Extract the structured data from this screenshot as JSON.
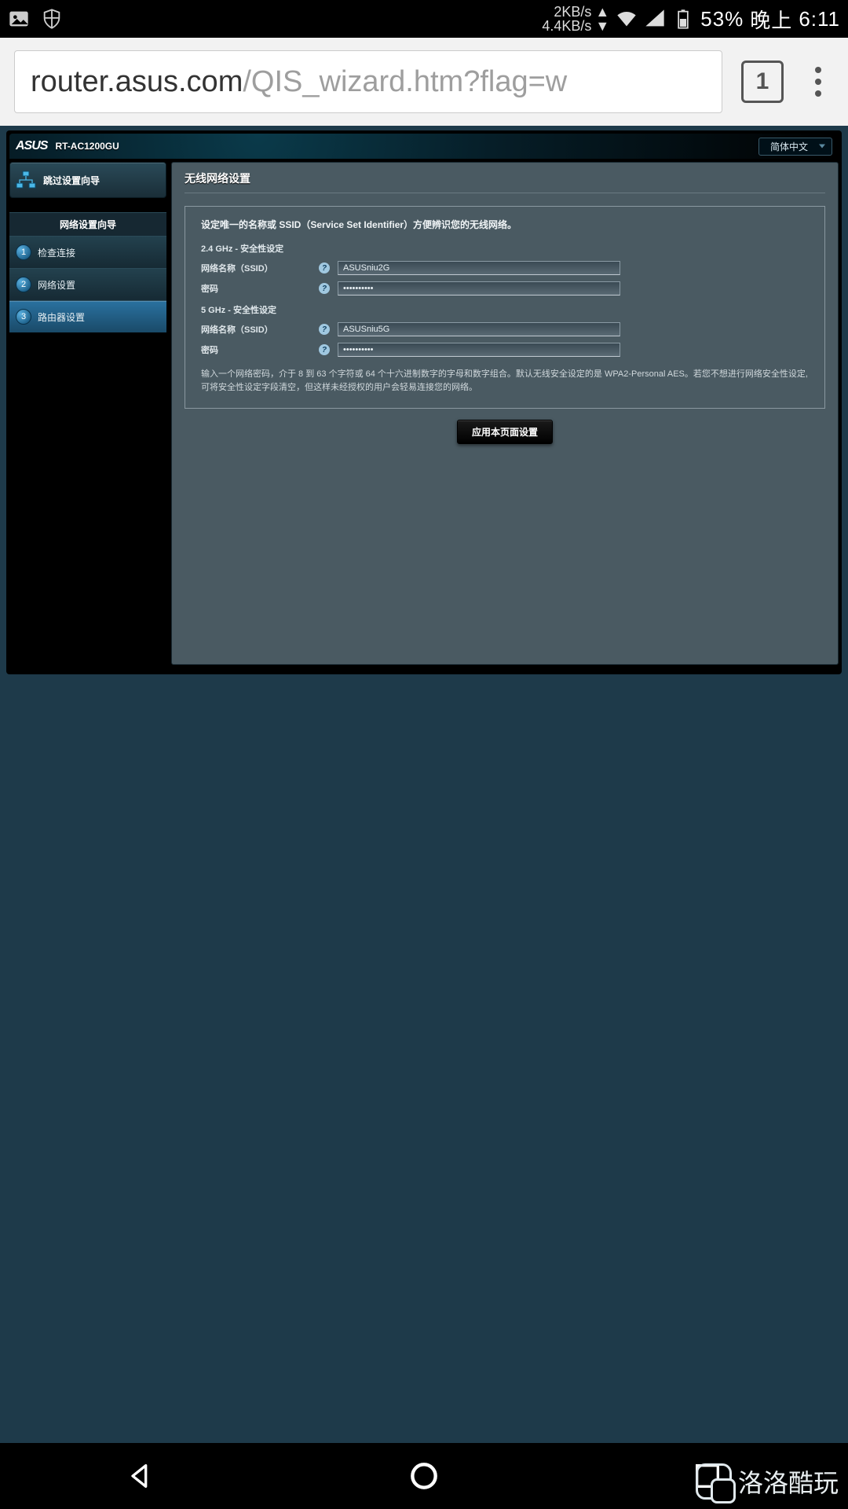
{
  "status": {
    "upload_speed": "2KB/s",
    "download_speed": "4.4KB/s",
    "battery": "53%",
    "time_prefix": "晚上",
    "time": "6:11"
  },
  "browser": {
    "url_host": "router.asus.com",
    "url_path": "/QIS_wizard.htm?flag=w",
    "tab_count": "1"
  },
  "router": {
    "brand": "ASUS",
    "model": "RT-AC1200GU",
    "language": "简体中文",
    "skip_wizard": "跳过设置向导",
    "wizard_header": "网络设置向导",
    "steps": [
      "检查连接",
      "网络设置",
      "路由器设置"
    ],
    "active_step": 2,
    "panel_title": "无线网络设置",
    "intro": "设定唯一的名称或 SSID（Service Set Identifier）方便辨识您的无线网络。",
    "band24_header": "2.4 GHz - 安全性设定",
    "band5_header": "5 GHz - 安全性设定",
    "ssid_label": "网络名称（SSID）",
    "pwd_label": "密码",
    "ssid_24": "ASUSniu2G",
    "pwd_24": "••••••••••",
    "ssid_5": "ASUSniu5G",
    "pwd_5": "••••••••••",
    "hint": "输入一个网络密码，介于 8 到 63 个字符或 64 个十六进制数字的字母和数字组合。默认无线安全设定的是 WPA2-Personal AES。若您不想进行网络安全性设定,可将安全性设定字段清空，但这样未经授权的用户会轻易连接您的网络。",
    "apply": "应用本页面设置"
  },
  "watermark": "洛洛酷玩"
}
